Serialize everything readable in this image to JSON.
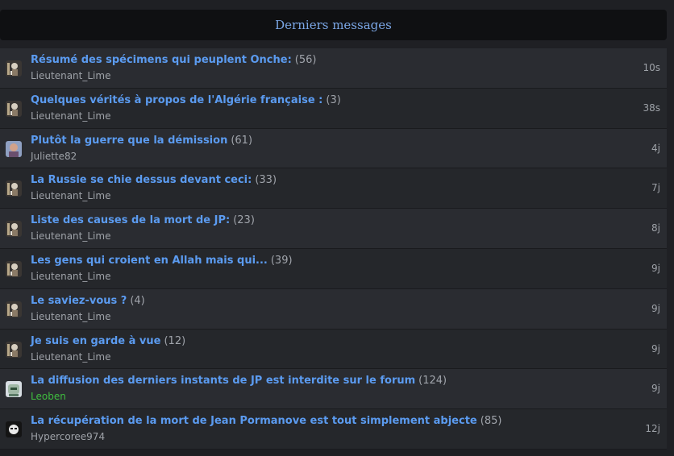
{
  "header": {
    "title": "Derniers messages"
  },
  "topics": [
    {
      "title": "Résumé des spécimens qui peuplent Onche:",
      "count": "(56)",
      "author": "Lieutenant_Lime",
      "time": "10s",
      "avatar": "mime-avatar",
      "author_color": "#9ea2a8"
    },
    {
      "title": "Quelques vérités à propos de l'Algérie française :",
      "count": "(3)",
      "author": "Lieutenant_Lime",
      "time": "38s",
      "avatar": "mime-avatar",
      "author_color": "#9ea2a8"
    },
    {
      "title": "Plutôt la guerre que la démission",
      "count": "(61)",
      "author": "Juliette82",
      "time": "4j",
      "avatar": "portrait-avatar",
      "author_color": "#9ea2a8"
    },
    {
      "title": "La Russie se chie dessus devant ceci:",
      "count": "(33)",
      "author": "Lieutenant_Lime",
      "time": "7j",
      "avatar": "mime-avatar",
      "author_color": "#9ea2a8"
    },
    {
      "title": "Liste des causes de la mort de JP:",
      "count": "(23)",
      "author": "Lieutenant_Lime",
      "time": "8j",
      "avatar": "mime-avatar",
      "author_color": "#9ea2a8"
    },
    {
      "title": "Les gens qui croient en Allah mais qui...",
      "count": "(39)",
      "author": "Lieutenant_Lime",
      "time": "9j",
      "avatar": "mime-avatar",
      "author_color": "#9ea2a8"
    },
    {
      "title": "Le saviez-vous ?",
      "count": "(4)",
      "author": "Lieutenant_Lime",
      "time": "9j",
      "avatar": "mime-avatar",
      "author_color": "#9ea2a8"
    },
    {
      "title": "Je suis en garde à vue",
      "count": "(12)",
      "author": "Lieutenant_Lime",
      "time": "9j",
      "avatar": "mime-avatar",
      "author_color": "#9ea2a8"
    },
    {
      "title": "La diffusion des derniers instants de JP est interdite sur le forum",
      "count": "(124)",
      "author": "Leoben",
      "time": "9j",
      "avatar": "robot-avatar",
      "author_color": "#3fbe3f"
    },
    {
      "title": "La récupération de la mort de Jean Pormanove est tout simplement abjecte",
      "count": "(85)",
      "author": "Hypercoree974",
      "time": "12j",
      "avatar": "masked-avatar",
      "author_color": "#9ea2a8"
    }
  ]
}
